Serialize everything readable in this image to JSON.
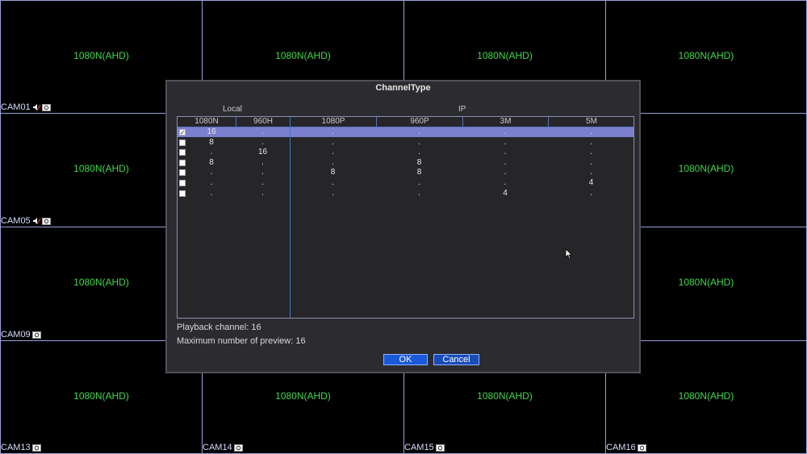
{
  "cameras": [
    {
      "label": "CAM01",
      "res": "1080N(AHD)",
      "audio": true
    },
    {
      "label": "",
      "res": "1080N(AHD)",
      "audio": false
    },
    {
      "label": "",
      "res": "1080N(AHD)",
      "audio": false
    },
    {
      "label": "",
      "res": "1080N(AHD)",
      "audio": true
    },
    {
      "label": "CAM05",
      "res": "1080N(AHD)",
      "audio": true
    },
    {
      "label": "",
      "res": "",
      "audio": false
    },
    {
      "label": "",
      "res": "",
      "audio": false
    },
    {
      "label": "",
      "res": "1080N(AHD)",
      "audio": true
    },
    {
      "label": "CAM09",
      "res": "1080N(AHD)",
      "audio": false
    },
    {
      "label": "",
      "res": "",
      "audio": false
    },
    {
      "label": "",
      "res": "",
      "audio": false
    },
    {
      "label": "",
      "res": "1080N(AHD)",
      "audio": false
    },
    {
      "label": "CAM13",
      "res": "1080N(AHD)",
      "audio": false
    },
    {
      "label": "CAM14",
      "res": "1080N(AHD)",
      "audio": false
    },
    {
      "label": "CAM15",
      "res": "1080N(AHD)",
      "audio": false
    },
    {
      "label": "CAM16",
      "res": "1080N(AHD)",
      "audio": false
    }
  ],
  "dialog": {
    "title": "ChannelType",
    "group_local": "Local",
    "group_ip": "IP",
    "columns": [
      "1080N",
      "960H",
      "1080P",
      "960P",
      "3M",
      "5M"
    ],
    "rows": [
      {
        "checked": true,
        "selected": true,
        "values": [
          "16",
          ".",
          ".",
          ".",
          ".",
          "."
        ]
      },
      {
        "checked": false,
        "selected": false,
        "values": [
          "8",
          ".",
          ".",
          ".",
          ".",
          "."
        ]
      },
      {
        "checked": false,
        "selected": false,
        "values": [
          ".",
          "16",
          ".",
          ".",
          ".",
          "."
        ]
      },
      {
        "checked": false,
        "selected": false,
        "values": [
          "8",
          ".",
          ".",
          "8",
          ".",
          "."
        ]
      },
      {
        "checked": false,
        "selected": false,
        "values": [
          ".",
          ".",
          "8",
          "8",
          ".",
          "."
        ]
      },
      {
        "checked": false,
        "selected": false,
        "values": [
          ".",
          ".",
          ".",
          ".",
          ".",
          "4"
        ]
      },
      {
        "checked": false,
        "selected": false,
        "values": [
          ".",
          ".",
          ".",
          ".",
          "4",
          "."
        ]
      }
    ],
    "playback": "Playback channel: 16",
    "max_preview": "Maximum number of preview: 16",
    "ok_label": "OK",
    "cancel_label": "Cancel",
    "check_mark": "✓"
  }
}
